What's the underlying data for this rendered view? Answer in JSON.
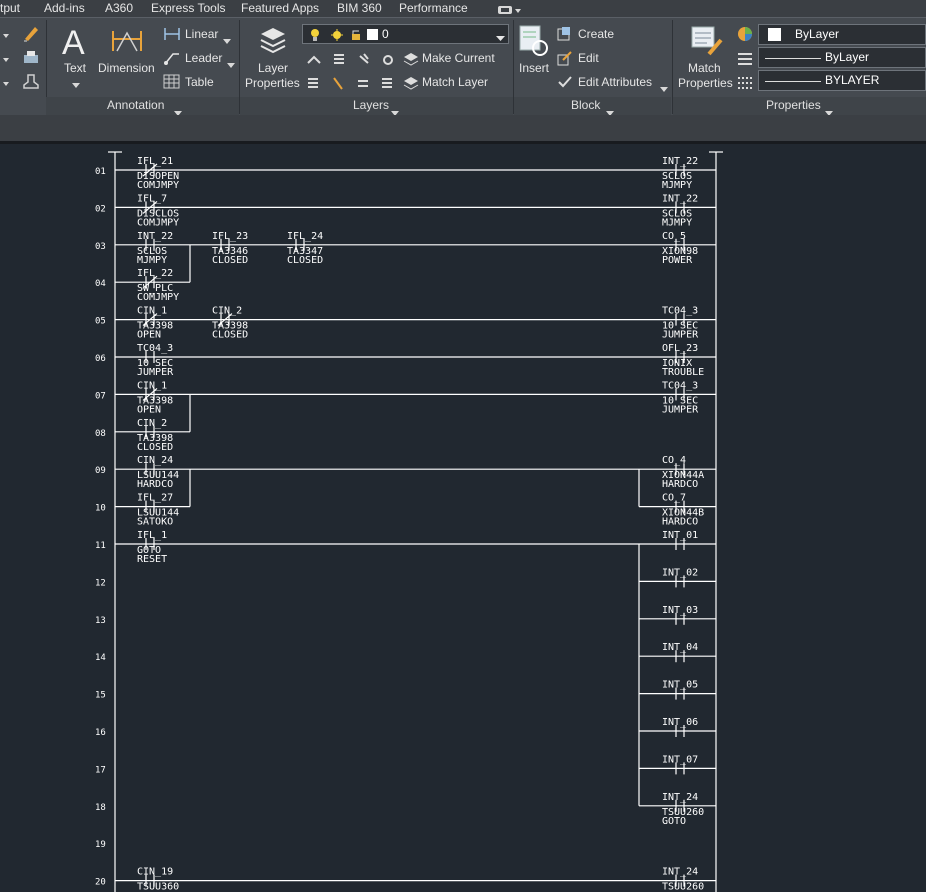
{
  "tabs": [
    "tput",
    "Add-ins",
    "A360",
    "Express Tools",
    "Featured Apps",
    "BIM 360",
    "Performance"
  ],
  "annotation": {
    "text_label": "Text",
    "dimension_label": "Dimension",
    "linear_label": "Linear",
    "leader_label": "Leader",
    "table_label": "Table",
    "group_title": "Annotation"
  },
  "layers": {
    "layer_properties_line1": "Layer",
    "layer_properties_line2": "Properties",
    "current_layer": "0",
    "make_current_label": "Make Current",
    "match_layer_label": "Match Layer",
    "group_title": "Layers"
  },
  "block": {
    "insert_label": "Insert",
    "create_label": "Create",
    "edit_label": "Edit",
    "edit_attributes_label": "Edit Attributes",
    "group_title": "Block"
  },
  "properties": {
    "match_line1": "Match",
    "match_line2": "Properties",
    "color_value": "ByLayer",
    "linetype_value": "ByLayer",
    "lineweight_value": "BYLAYER",
    "group_title": "Properties"
  },
  "drawing": {
    "rungs": [
      "01",
      "02",
      "03",
      "04",
      "05",
      "06",
      "07",
      "08",
      "09",
      "10",
      "11",
      "12",
      "13",
      "14",
      "15",
      "16",
      "17",
      "18",
      "19",
      "20"
    ],
    "contacts": [
      {
        "tag": "IFL_21",
        "d1": "DISOPEN",
        "d2": "COMJMPY"
      },
      {
        "tag": "IFL_7",
        "d1": "DISCLOS",
        "d2": "COMJMPY"
      },
      {
        "tag": "INT_22",
        "d1": "SCLOS",
        "d2": "MJMPY"
      },
      {
        "tag": "IFL_23",
        "d1": "TA3346",
        "d2": "CLOSED"
      },
      {
        "tag": "IFL_24",
        "d1": "TA3347",
        "d2": "CLOSED"
      },
      {
        "tag": "IFL_22",
        "d1": "SW_PLC",
        "d2": "COMJMPY"
      },
      {
        "tag": "CIN_1",
        "d1": "TA3398",
        "d2": "OPEN"
      },
      {
        "tag": "CIN_2",
        "d1": "TA3398",
        "d2": "CLOSED"
      },
      {
        "tag": "TC04_3",
        "d1": "10 SEC",
        "d2": "JUMPER"
      },
      {
        "tag": "CIN_1",
        "d1": "TA3398",
        "d2": "OPEN"
      },
      {
        "tag": "CIN_2",
        "d1": "TA3398",
        "d2": "CLOSED"
      },
      {
        "tag": "CIN_24",
        "d1": "LSUU144",
        "d2": "HARDCO"
      },
      {
        "tag": "IFL_27",
        "d1": "LSUU144",
        "d2": "SATOKO"
      },
      {
        "tag": "IFL_1",
        "d1": "GOTO",
        "d2": "RESET"
      },
      {
        "tag": "CIN_19",
        "d1": "TSUU360",
        "d2": ""
      }
    ],
    "coils": [
      {
        "tag": "INT_22",
        "d1": "SCLOS",
        "d2": "MJMPY"
      },
      {
        "tag": "INT_22",
        "d1": "SCLOS",
        "d2": "MJMPY"
      },
      {
        "tag": "CO_5",
        "d1": "XION98",
        "d2": "POWER"
      },
      {
        "tag": "TC04_3",
        "d1": "10 SEC",
        "d2": "JUMPER"
      },
      {
        "tag": "OFL_23",
        "d1": "IONIX",
        "d2": "TROUBLE"
      },
      {
        "tag": "TC04_3",
        "d1": "10 SEC",
        "d2": "JUMPER"
      },
      {
        "tag": "CO_4",
        "d1": "XION44A",
        "d2": "HARDCO"
      },
      {
        "tag": "CO_7",
        "d1": "XION44B",
        "d2": "HARDCO"
      },
      {
        "tag": "INT_01",
        "d1": "",
        "d2": ""
      },
      {
        "tag": "INT_02",
        "d1": "",
        "d2": ""
      },
      {
        "tag": "INT_03",
        "d1": "",
        "d2": ""
      },
      {
        "tag": "INT_04",
        "d1": "",
        "d2": ""
      },
      {
        "tag": "INT_05",
        "d1": "",
        "d2": ""
      },
      {
        "tag": "INT_06",
        "d1": "",
        "d2": ""
      },
      {
        "tag": "INT_07",
        "d1": "",
        "d2": ""
      },
      {
        "tag": "INT_24",
        "d1": "TSUU260",
        "d2": "GOTO"
      },
      {
        "tag": "INT_24",
        "d1": "TSUU260",
        "d2": ""
      }
    ]
  }
}
